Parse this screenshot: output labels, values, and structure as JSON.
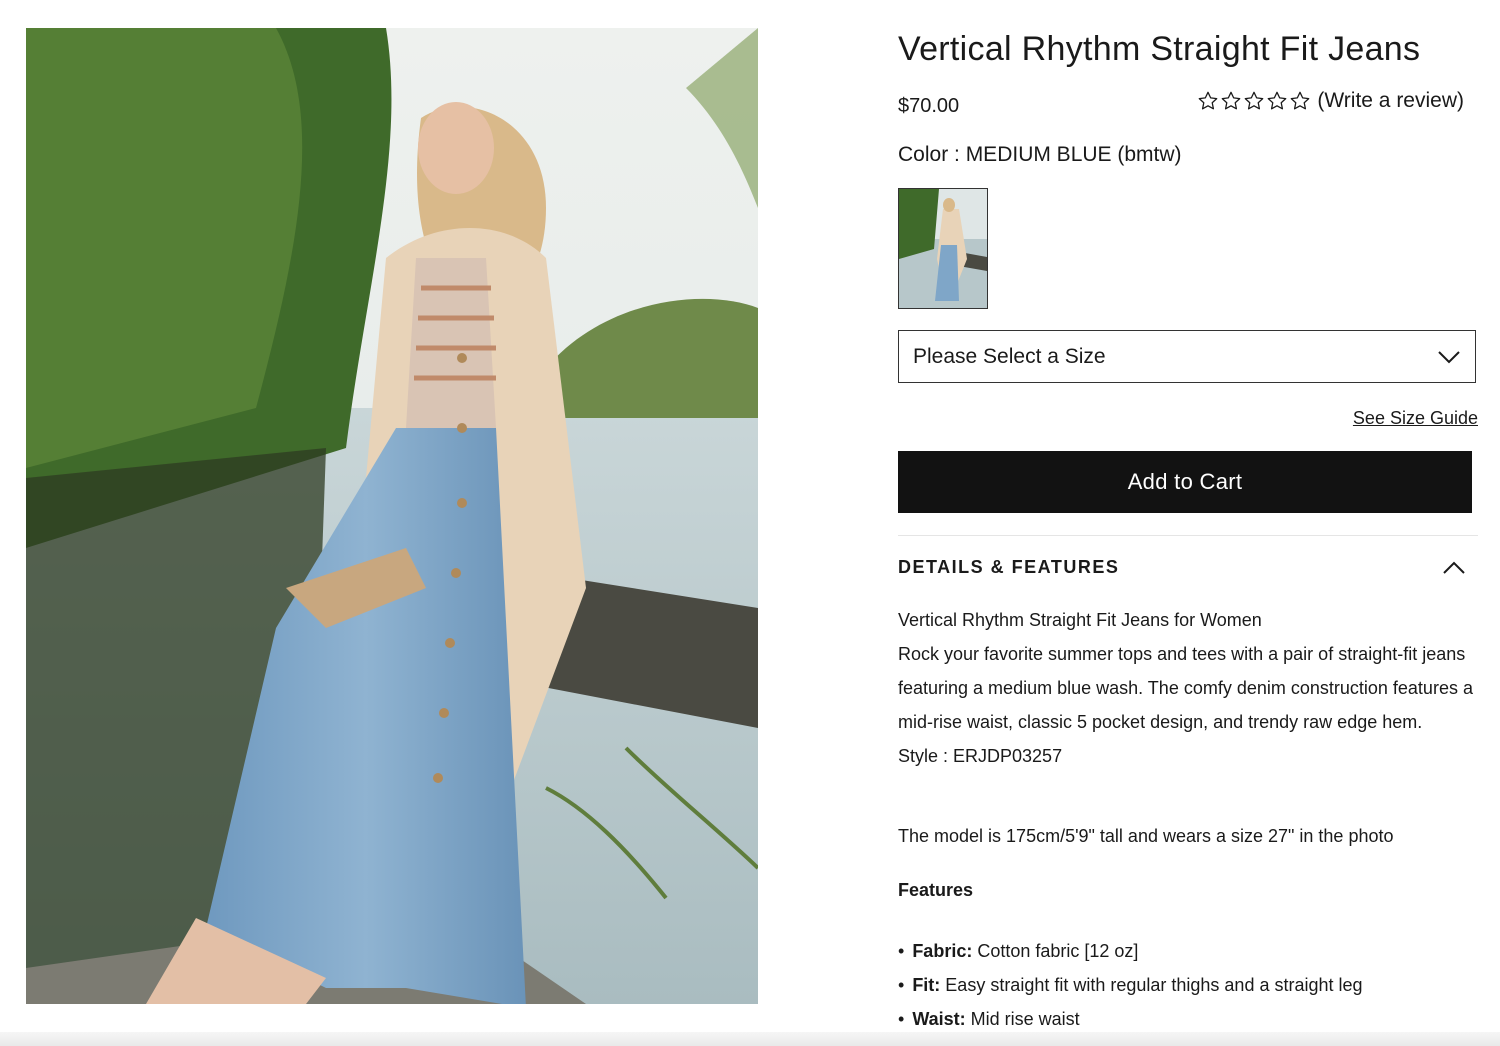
{
  "product": {
    "title": "Vertical Rhythm Straight Fit Jeans",
    "price": "$70.00",
    "rating_stars": 0,
    "rating_max": 5,
    "review_link": "(Write a review)",
    "color_label": "Color : ",
    "color_value": "MEDIUM BLUE (bmtw)"
  },
  "size": {
    "placeholder": "Please Select a Size",
    "guide_link": "See Size Guide"
  },
  "cart": {
    "button_label": "Add to Cart"
  },
  "details": {
    "heading": "DETAILS & FEATURES",
    "subtitle": "Vertical Rhythm Straight Fit Jeans for Women",
    "description": "Rock your favorite summer tops and tees with a pair of straight-fit jeans featuring a medium blue wash. The comfy denim construction features a mid-rise waist, classic 5 pocket design, and trendy raw edge hem.",
    "style": "Style : ERJDP03257",
    "model_note": "The model is 175cm/5'9\" tall and wears a size 27\" in the photo",
    "features_heading": "Features",
    "features": [
      {
        "label": "Fabric:",
        "text": " Cotton fabric [12 oz]"
      },
      {
        "label": "Fit:",
        "text": " Easy straight fit with regular thighs and a straight leg"
      },
      {
        "label": "Waist:",
        "text": " Mid rise waist"
      }
    ]
  },
  "colors": {
    "button_bg": "#121212",
    "text": "#1a1a1a",
    "denim": "#7fa6c8",
    "cardigan": "#e8d3b8"
  },
  "icons": {
    "rating": "star-outline-icon",
    "select": "chevron-down-icon",
    "accordion": "chevron-up-icon"
  }
}
